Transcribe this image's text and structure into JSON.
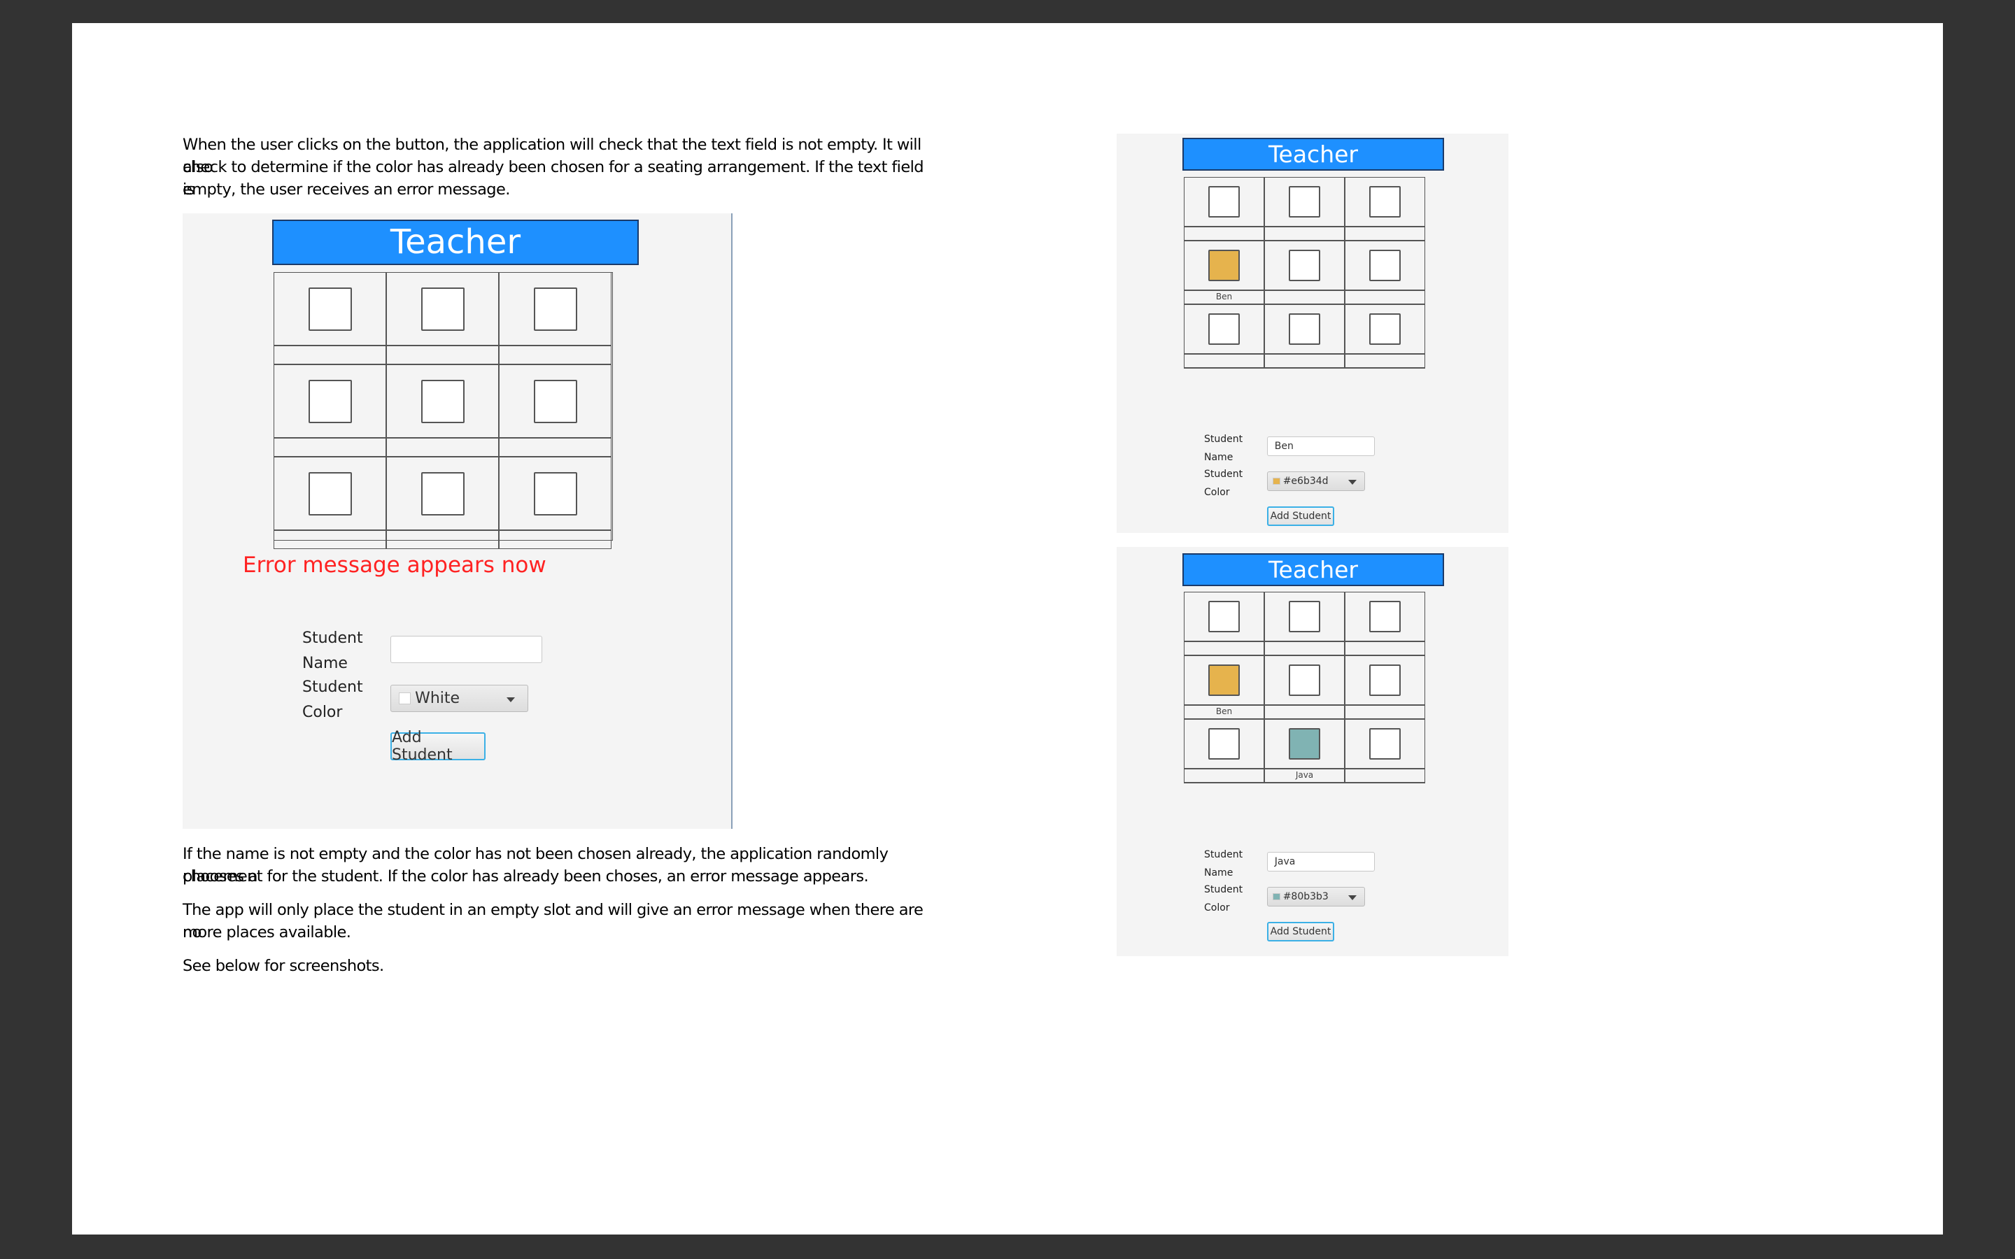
{
  "paragraphs": {
    "intro": [
      "When the user clicks on the button, the application will check that the text field is not empty. It will also",
      "check to determine if the color has already been chosen for a seating arrangement. If the text field is",
      "empty, the user receives an error message."
    ],
    "after1": [
      "If the name is not empty and the color has not been chosen already, the application randomly chooses a",
      "placement for the student. If the color has already been choses, an error message appears."
    ],
    "after2": [
      "The app will only place the student in an empty slot and will give an error message when there are no",
      "more places available."
    ],
    "after3": [
      "See below for screenshots."
    ]
  },
  "panels": [
    {
      "header": "Teacher",
      "error": "Error message appears now",
      "name_label": [
        "Student",
        "Name"
      ],
      "color_label": [
        "Student",
        "Color"
      ],
      "name_value": "",
      "color_value": "White",
      "color_swatch": "#ffffff",
      "button": "Add Student",
      "seats": [
        [
          "",
          ""
        ],
        [
          "",
          ""
        ],
        [
          "",
          ""
        ],
        [
          "",
          ""
        ],
        [
          "",
          ""
        ],
        [
          "",
          ""
        ],
        [
          "",
          ""
        ],
        [
          "",
          ""
        ],
        [
          "",
          ""
        ]
      ]
    },
    {
      "header": "Teacher",
      "name_label": [
        "Student",
        "Name"
      ],
      "color_label": [
        "Student",
        "Color"
      ],
      "name_value": "Ben",
      "color_value": "#e6b34d",
      "color_swatch": "#e6b34d",
      "button": "Add Student",
      "seats": [
        [
          "",
          ""
        ],
        [
          "",
          ""
        ],
        [
          "",
          ""
        ],
        [
          "#e6b34d",
          "Ben"
        ],
        [
          "",
          ""
        ],
        [
          "",
          ""
        ],
        [
          "",
          ""
        ],
        [
          "",
          ""
        ],
        [
          "",
          ""
        ]
      ]
    },
    {
      "header": "Teacher",
      "name_label": [
        "Student",
        "Name"
      ],
      "color_label": [
        "Student",
        "Color"
      ],
      "name_value": "Java",
      "color_value": "#80b3b3",
      "color_swatch": "#80b3b3",
      "button": "Add Student",
      "seats": [
        [
          "",
          ""
        ],
        [
          "",
          ""
        ],
        [
          "",
          ""
        ],
        [
          "#e6b34d",
          "Ben"
        ],
        [
          "",
          ""
        ],
        [
          "",
          ""
        ],
        [
          "",
          ""
        ],
        [
          "#80b3b3",
          "Java"
        ],
        [
          "",
          ""
        ]
      ]
    }
  ]
}
